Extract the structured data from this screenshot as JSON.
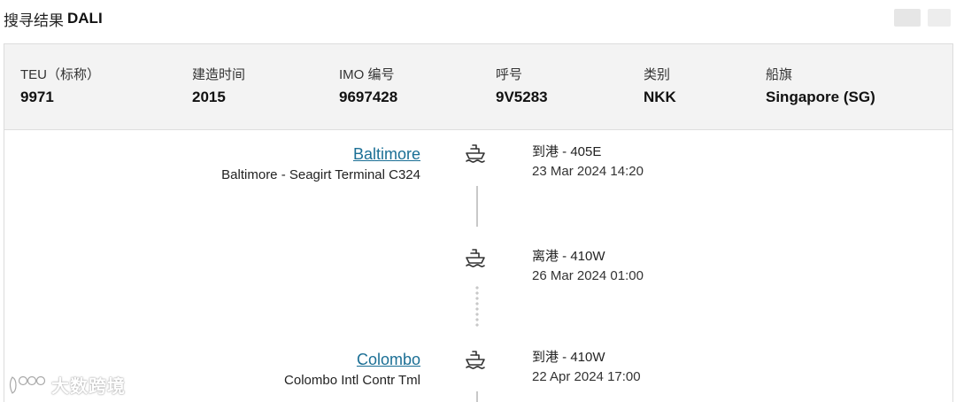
{
  "header": {
    "prefix": "搜寻结果",
    "vessel_name": "DALI"
  },
  "summary": {
    "fields": [
      {
        "label": "TEU（标称）",
        "value": "9971"
      },
      {
        "label": "建造时间",
        "value": "2015"
      },
      {
        "label": "IMO 编号",
        "value": "9697428"
      },
      {
        "label": "呼号",
        "value": "9V5283"
      },
      {
        "label": "类别",
        "value": "NKK"
      },
      {
        "label": "船旗",
        "value": "Singapore (SG)"
      }
    ]
  },
  "timeline": {
    "stops": [
      {
        "port": "Baltimore",
        "terminal": "Baltimore - Seagirt Terminal C324",
        "events": [
          {
            "type": "到港 - 405E",
            "time": "23 Mar 2024 14:20",
            "icon": "ship-icon"
          },
          {
            "type": "离港 - 410W",
            "time": "26 Mar 2024 01:00",
            "icon": "ship-icon"
          }
        ]
      },
      {
        "port": "Colombo",
        "terminal": "Colombo Intl Contr Tml",
        "events": [
          {
            "type": "到港 - 410W",
            "time": "22 Apr 2024 17:00",
            "icon": "ship-icon"
          }
        ]
      }
    ]
  },
  "watermark": {
    "text": "大数跨境"
  },
  "colors": {
    "link": "#1b6f95",
    "summary_bg": "#f3f3f3",
    "timeline_line": "#c8c8c8"
  }
}
